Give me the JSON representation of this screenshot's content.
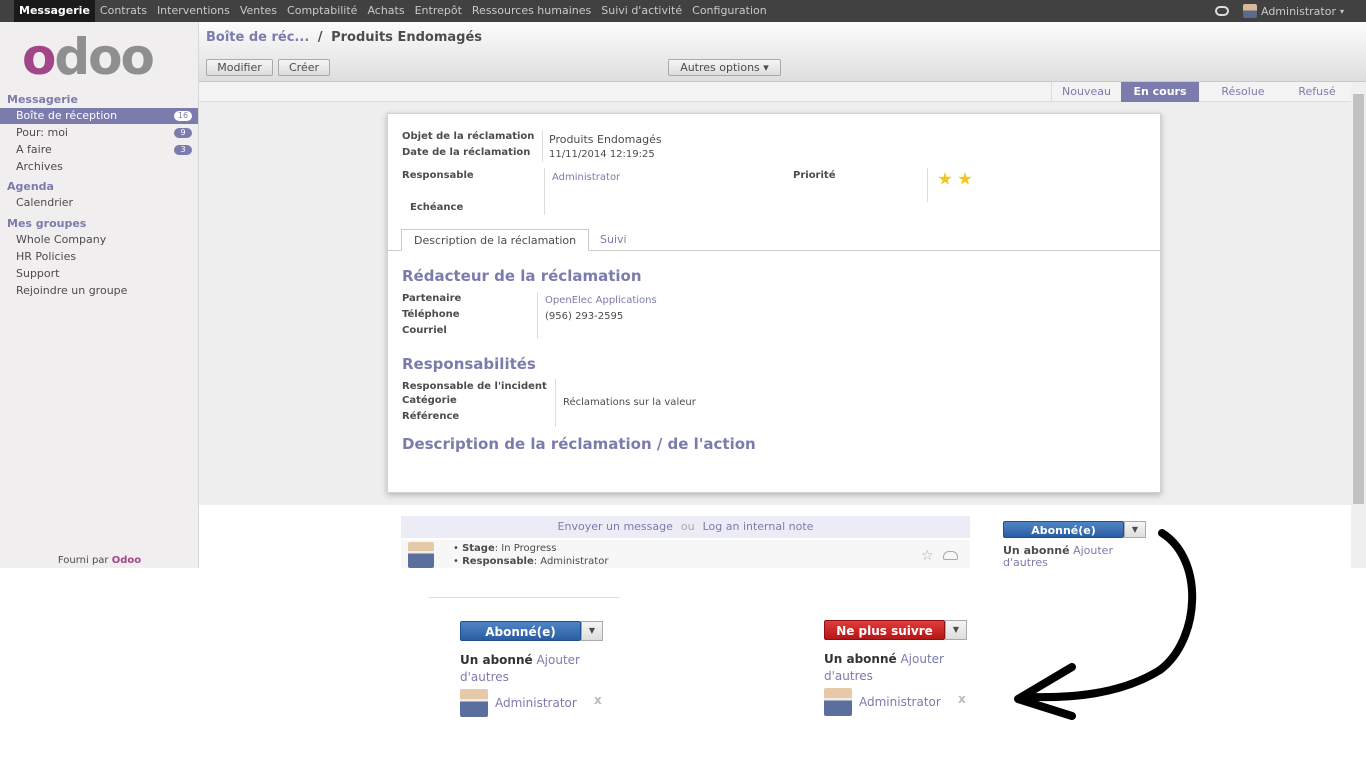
{
  "topbar": {
    "menus": [
      "Messagerie",
      "Contrats",
      "Interventions",
      "Ventes",
      "Comptabilité",
      "Achats",
      "Entrepôt",
      "Ressources humaines",
      "Suivi d'activité",
      "Configuration"
    ],
    "user": "Administrator",
    "user_caret": "▾"
  },
  "sidebar": {
    "logo_a": "o",
    "logo_b": "d",
    "logo_c": "oo",
    "sections": {
      "messagerie": "Messagerie",
      "agenda": "Agenda",
      "groups": "Mes groupes"
    },
    "items": [
      {
        "label": "Boîte de réception",
        "badge": "16"
      },
      {
        "label": "Pour: moi",
        "badge": "9"
      },
      {
        "label": "A faire",
        "badge": "3"
      },
      {
        "label": "Archives",
        "badge": ""
      }
    ],
    "agenda_items": [
      "Calendrier"
    ],
    "group_items": [
      "Whole Company",
      "HR Policies",
      "Support",
      "Rejoindre un groupe"
    ],
    "powered_by": "Fourni par",
    "powered_brand": "Odoo"
  },
  "header": {
    "crumb_link": "Boîte de réc...",
    "crumb_sep": "/",
    "crumb_current": "Produits Endomagés",
    "edit_label": "Modifier",
    "create_label": "Créer",
    "more_label": "Autres options ▾"
  },
  "stages": [
    "Nouveau",
    "En cours",
    "Résolue",
    "Refusé"
  ],
  "form": {
    "subject_label": "Objet de la réclamation",
    "subject_value": "Produits Endomagés",
    "date_label": "Date de la réclamation",
    "date_value": "11/11/2014 12:19:25",
    "responsible_label": "Responsable",
    "responsible_value": "Administrator",
    "deadline_label": "Echéance",
    "priority_label": "Priorité",
    "priority_stars": 2,
    "tabs": [
      "Description de la réclamation",
      "Suivi"
    ],
    "sec1_title": "Rédacteur de la réclamation",
    "partner_label": "Partenaire",
    "partner_value": "OpenElec Applications",
    "phone_label": "Téléphone",
    "phone_value": "(956) 293-2595",
    "email_label": "Courriel",
    "sec2_title": "Responsabilités",
    "incident_label": "Responsable de l'incident",
    "category_label": "Catégorie",
    "category_value": "Réclamations sur la valeur",
    "reference_label": "Référence",
    "sec3_title": "Description de la réclamation / de l'action"
  },
  "chatter": {
    "send_message": "Envoyer un message",
    "or": "ou",
    "log_note": "Log an internal note",
    "stage_label": "Stage",
    "stage_value": ": In Progress",
    "resp_label": "Responsable",
    "resp_value": ": Administrator",
    "subscribed": "Abonné(e)",
    "one_follower": "Un abonné",
    "add_others_1": "Ajouter",
    "add_others_2": "d'autres"
  },
  "bottom": {
    "subscribed": "Abonné(e)",
    "unfollow": "Ne plus suivre",
    "one_follower": "Un abonné",
    "add_others_1": "Ajouter",
    "add_others_2": "d'autres",
    "follower_name": "Administrator",
    "remove": "x"
  },
  "colors": {
    "accent": "#7c7bad",
    "brand": "#a24689",
    "blue": "#2a5ea3",
    "red": "#b21717"
  }
}
